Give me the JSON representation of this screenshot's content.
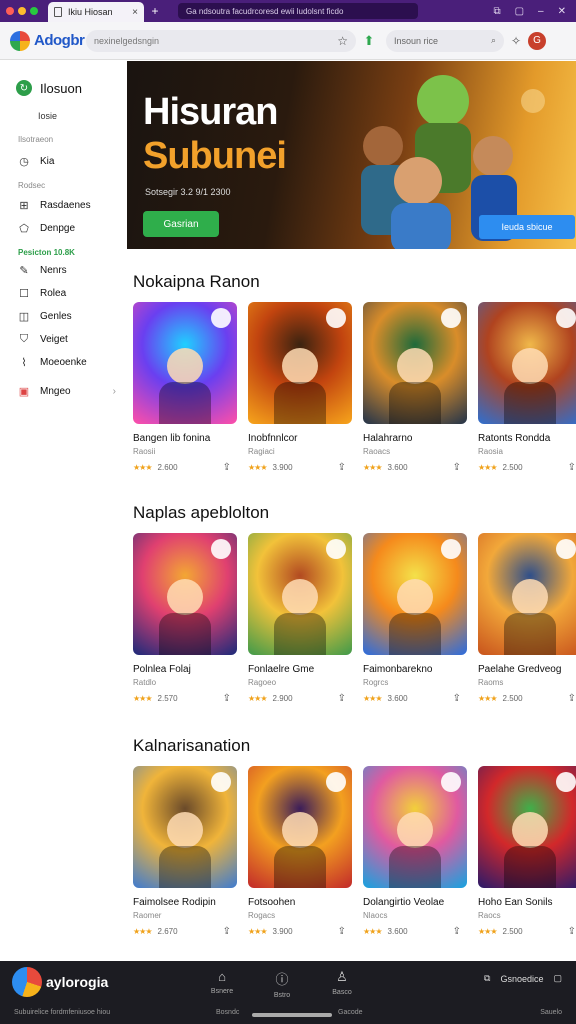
{
  "browser": {
    "tab_title": "Ikiu Hiosan",
    "address_strip": "Ga ndsoutra facudrcoresd ewii ludolsnt ficdo",
    "omnibox_text": "nexinelgedsngin",
    "search_placeholder": "Insoun rice",
    "logo_text": "Adogbr",
    "avatar_letter": "G"
  },
  "sidebar": {
    "brand": "Ilosuon",
    "brand_sub": "Iosie",
    "sections": [
      {
        "label": "Ilsotraeon"
      },
      {
        "label": "Rodsec"
      },
      {
        "label": "Pesicton 10.8K"
      }
    ],
    "items": [
      {
        "label": "Kia",
        "icon": "clock-icon"
      },
      {
        "label": "Rasdaenes",
        "icon": "grid-icon"
      },
      {
        "label": "Denpge",
        "icon": "pentagon-icon"
      },
      {
        "label": "Nenrs",
        "icon": "pencil-icon"
      },
      {
        "label": "Rolea",
        "icon": "chat-icon"
      },
      {
        "label": "Genles",
        "icon": "gamepad-icon"
      },
      {
        "label": "Veiget",
        "icon": "shield-icon"
      },
      {
        "label": "Moeoenke",
        "icon": "chart-icon"
      },
      {
        "label": "Mngeo",
        "icon": "app-icon"
      }
    ]
  },
  "hero": {
    "line1": "Hisuran",
    "line2": "Subunei",
    "date": "Sotsegir 3.2  9/1 2300",
    "cta": "Gasrian",
    "cta2": "Ieuda sbicue"
  },
  "sections": [
    {
      "title": "Nokaipna Ranon",
      "cards": [
        {
          "name": "Bangen lib fonina",
          "cat": "Raosii",
          "rating": "2.600"
        },
        {
          "name": "Inobfnnlcor",
          "cat": "Ragiaci",
          "rating": "3.900"
        },
        {
          "name": "Halahrarno",
          "cat": "Raoacs",
          "rating": "3.600"
        },
        {
          "name": "Ratonts Rondda",
          "cat": "Raosia",
          "rating": "2.500"
        }
      ]
    },
    {
      "title": "Naplas apeblolton",
      "cards": [
        {
          "name": "Polnlea Folaj",
          "cat": "Ratdlo",
          "rating": "2.570"
        },
        {
          "name": "Fonlaelre Gme",
          "cat": "Ragoeo",
          "rating": "2.900"
        },
        {
          "name": "Faimonbarekno",
          "cat": "Rogrcs",
          "rating": "3.600"
        },
        {
          "name": "Paelahe Gredveog",
          "cat": "Raoms",
          "rating": "2.500"
        }
      ]
    },
    {
      "title": "Kalnarisanation",
      "cards": [
        {
          "name": "Faimolsee Rodipin",
          "cat": "Raomer",
          "rating": "2.670"
        },
        {
          "name": "Fotsoohen",
          "cat": "Rogacs",
          "rating": "3.900"
        },
        {
          "name": "Dolangirtio Veolae",
          "cat": "Nlaocs",
          "rating": "3.600"
        },
        {
          "name": "Hoho Ean Sonils",
          "cat": "Raocs",
          "rating": "2.500"
        }
      ]
    }
  ],
  "bottom": {
    "brand": "aylorogia",
    "tabs": [
      "Bsnere",
      "Bstro",
      "Basco"
    ],
    "right_label": "Gsnoedice",
    "foot_left": "Subuirelice fordmfeniusoe hiou",
    "foot_center": "Bosndc",
    "foot_center2": "Gacode",
    "foot_right": "Sauelo"
  },
  "colors": {
    "tab_strip": "#4a1f7a",
    "accent_green": "#2fae4b",
    "accent_blue": "#2d8df0",
    "star": "#f0a21b",
    "bottom_bar": "#1c1c22"
  }
}
